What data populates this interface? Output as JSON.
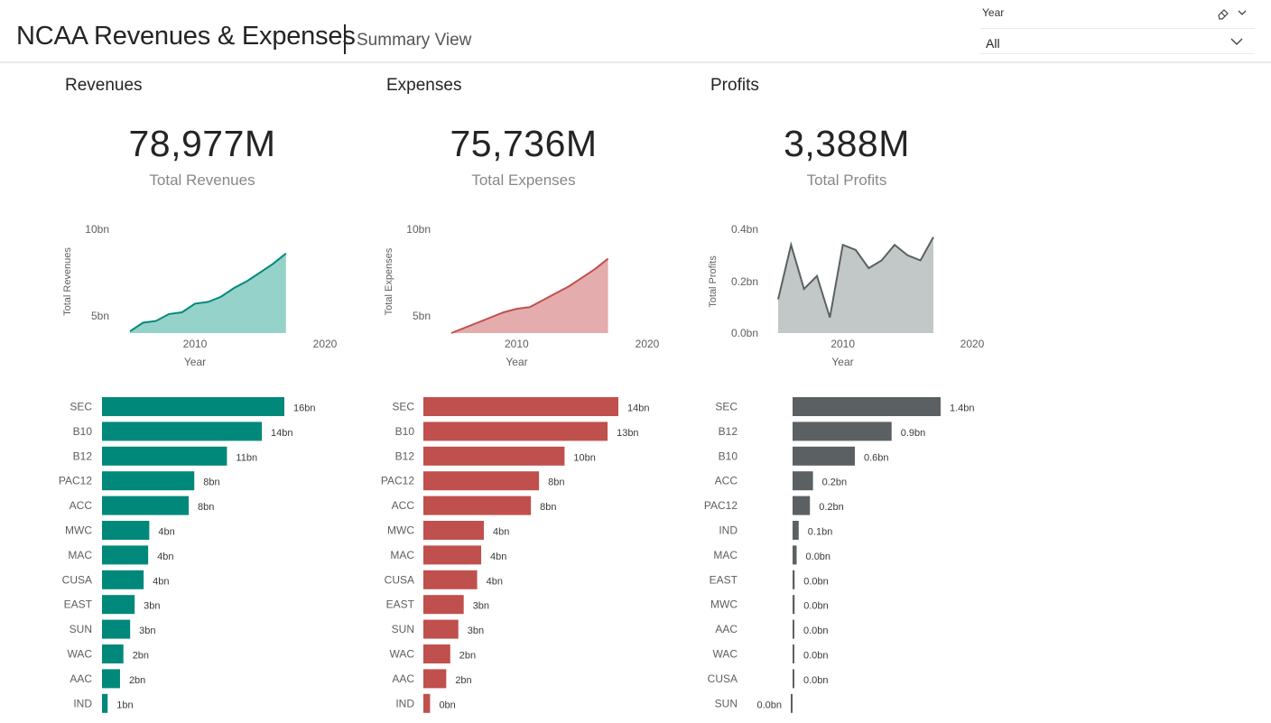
{
  "header": {
    "title": "NCAA Revenues & Expenses",
    "subtitle": "Summary View"
  },
  "slicer": {
    "label": "Year",
    "value": "All",
    "icons": [
      "eraser-icon",
      "chevron-down-icon"
    ]
  },
  "panels": [
    {
      "title": "Revenues",
      "kpi_value": "78,977M",
      "kpi_label": "Total Revenues"
    },
    {
      "title": "Expenses",
      "kpi_value": "75,736M",
      "kpi_label": "Total Expenses"
    },
    {
      "title": "Profits",
      "kpi_value": "3,388M",
      "kpi_label": "Total Profits"
    }
  ],
  "colors": {
    "revenues": "#00897b",
    "revenues_fill": "#8fd0c6",
    "expenses": "#c0504d",
    "expenses_fill": "#e3a8a8",
    "profits": "#5b6163",
    "profits_fill": "#bfc5c5",
    "axis_text": "#605e5c"
  },
  "chart_data": [
    {
      "type": "area",
      "ylabel": "Total Revenues",
      "xlabel": "Year",
      "y_ticks": [
        "10bn",
        "5bn"
      ],
      "x_ticks": [
        "2010",
        "2020"
      ],
      "ylim": [
        4,
        10
      ],
      "xlim": [
        2005,
        2020
      ],
      "x": [
        2005,
        2006,
        2007,
        2008,
        2009,
        2010,
        2011,
        2012,
        2013,
        2014,
        2015,
        2016,
        2017
      ],
      "values": [
        4.1,
        4.6,
        4.7,
        5.1,
        5.2,
        5.7,
        5.8,
        6.1,
        6.6,
        7.0,
        7.5,
        8.0,
        8.6
      ]
    },
    {
      "type": "area",
      "ylabel": "Total Expenses",
      "xlabel": "Year",
      "y_ticks": [
        "10bn",
        "5bn"
      ],
      "x_ticks": [
        "2010",
        "2020"
      ],
      "ylim": [
        4,
        10
      ],
      "xlim": [
        2005,
        2020
      ],
      "x": [
        2005,
        2006,
        2007,
        2008,
        2009,
        2010,
        2011,
        2012,
        2013,
        2014,
        2015,
        2016,
        2017
      ],
      "values": [
        4.0,
        4.3,
        4.6,
        4.9,
        5.2,
        5.4,
        5.5,
        5.9,
        6.3,
        6.7,
        7.2,
        7.7,
        8.3
      ]
    },
    {
      "type": "area",
      "ylabel": "Total Profits",
      "xlabel": "Year",
      "y_ticks": [
        "0.4bn",
        "0.2bn",
        "0.0bn"
      ],
      "x_ticks": [
        "2010",
        "2020"
      ],
      "ylim": [
        0,
        0.4
      ],
      "xlim": [
        2005,
        2020
      ],
      "x": [
        2005,
        2006,
        2007,
        2008,
        2009,
        2010,
        2011,
        2012,
        2013,
        2014,
        2015,
        2016,
        2017
      ],
      "values": [
        0.13,
        0.34,
        0.17,
        0.22,
        0.06,
        0.34,
        0.32,
        0.25,
        0.28,
        0.34,
        0.3,
        0.28,
        0.37
      ]
    },
    {
      "type": "bar",
      "orientation": "horizontal",
      "categories": [
        "SEC",
        "B10",
        "B12",
        "PAC12",
        "ACC",
        "MWC",
        "MAC",
        "CUSA",
        "EAST",
        "SUN",
        "WAC",
        "AAC",
        "IND"
      ],
      "values": [
        16.2,
        14.2,
        11.1,
        8.2,
        7.7,
        4.2,
        4.1,
        3.7,
        2.9,
        2.5,
        1.9,
        1.6,
        0.5
      ],
      "labels": [
        "16bn",
        "14bn",
        "11bn",
        "8bn",
        "8bn",
        "4bn",
        "4bn",
        "4bn",
        "3bn",
        "3bn",
        "2bn",
        "2bn",
        "1bn"
      ],
      "xlim": [
        0,
        16.2
      ]
    },
    {
      "type": "bar",
      "orientation": "horizontal",
      "categories": [
        "SEC",
        "B10",
        "B12",
        "PAC12",
        "ACC",
        "MWC",
        "MAC",
        "CUSA",
        "EAST",
        "SUN",
        "WAC",
        "AAC",
        "IND"
      ],
      "values": [
        14.5,
        13.7,
        10.5,
        8.6,
        8.0,
        4.5,
        4.3,
        4.0,
        3.0,
        2.6,
        2.0,
        1.7,
        0.5
      ],
      "labels": [
        "14bn",
        "13bn",
        "10bn",
        "8bn",
        "8bn",
        "4bn",
        "4bn",
        "4bn",
        "3bn",
        "3bn",
        "2bn",
        "2bn",
        "0bn"
      ],
      "xlim": [
        0,
        14.5
      ]
    },
    {
      "type": "bar",
      "orientation": "horizontal",
      "categories": [
        "SEC",
        "B12",
        "B10",
        "ACC",
        "PAC12",
        "IND",
        "MAC",
        "EAST",
        "MWC",
        "AAC",
        "WAC",
        "CUSA",
        "SUN"
      ],
      "values": [
        1.45,
        0.97,
        0.61,
        0.2,
        0.17,
        0.06,
        0.04,
        0.02,
        0.02,
        0.01,
        0.01,
        0.01,
        -0.01
      ],
      "labels": [
        "1.4bn",
        "0.9bn",
        "0.6bn",
        "0.2bn",
        "0.2bn",
        "0.1bn",
        "0.0bn",
        "0.0bn",
        "0.0bn",
        "0.0bn",
        "0.0bn",
        "0.0bn",
        "0.0bn"
      ],
      "xlim": [
        0,
        1.45
      ]
    }
  ]
}
